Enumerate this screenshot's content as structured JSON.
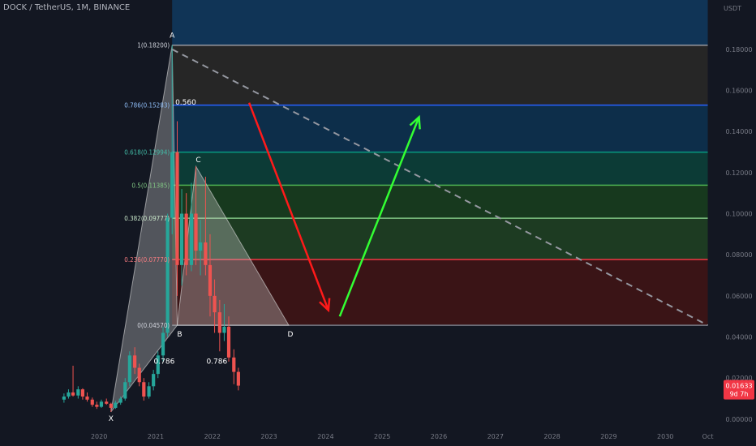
{
  "header": {
    "symbol": "DOCK / TetherUS",
    "interval": "1M",
    "exchange": "BINANCE"
  },
  "price_badge": {
    "price": "0.01633",
    "countdown": "9d 7h",
    "color": "#f23645"
  },
  "chart_data": {
    "type": "candlestick",
    "y_unit": "USDT",
    "ylim": [
      -0.004,
      0.204
    ],
    "y_ticks": [
      "0.18000",
      "0.16000",
      "0.14000",
      "0.12000",
      "0.10000",
      "0.08000",
      "0.06000",
      "0.04000",
      "0.02000",
      "0.00000"
    ],
    "y_tick_values": [
      0.18,
      0.16,
      0.14,
      0.12,
      0.1,
      0.08,
      0.06,
      0.04,
      0.02,
      0.0
    ],
    "x_ticks": [
      "2020",
      "2021",
      "2022",
      "2023",
      "2024",
      "2025",
      "2026",
      "2027",
      "2028",
      "2029",
      "2030",
      "Oct"
    ],
    "x_tick_years": [
      2020,
      2021,
      2022,
      2023,
      2024,
      2025,
      2026,
      2027,
      2028,
      2029,
      2030,
      2030.75
    ],
    "xlim": [
      2018.25,
      2031.0
    ],
    "candle_colors": {
      "up": "#26a69a",
      "down": "#ef5350"
    },
    "candles": [
      {
        "t": 2019.38,
        "o": 0.0095,
        "h": 0.0125,
        "l": 0.008,
        "c": 0.011
      },
      {
        "t": 2019.46,
        "o": 0.011,
        "h": 0.0145,
        "l": 0.01,
        "c": 0.013
      },
      {
        "t": 2019.54,
        "o": 0.013,
        "h": 0.026,
        "l": 0.011,
        "c": 0.0115
      },
      {
        "t": 2019.63,
        "o": 0.0115,
        "h": 0.016,
        "l": 0.01,
        "c": 0.0145
      },
      {
        "t": 2019.71,
        "o": 0.0145,
        "h": 0.015,
        "l": 0.0095,
        "c": 0.011
      },
      {
        "t": 2019.79,
        "o": 0.011,
        "h": 0.013,
        "l": 0.0085,
        "c": 0.0095
      },
      {
        "t": 2019.88,
        "o": 0.0095,
        "h": 0.0105,
        "l": 0.006,
        "c": 0.007
      },
      {
        "t": 2019.96,
        "o": 0.007,
        "h": 0.0085,
        "l": 0.005,
        "c": 0.006
      },
      {
        "t": 2020.04,
        "o": 0.006,
        "h": 0.0095,
        "l": 0.0055,
        "c": 0.0085
      },
      {
        "t": 2020.13,
        "o": 0.0085,
        "h": 0.01,
        "l": 0.007,
        "c": 0.0075
      },
      {
        "t": 2020.21,
        "o": 0.0075,
        "h": 0.008,
        "l": 0.0035,
        "c": 0.0055
      },
      {
        "t": 2020.29,
        "o": 0.0055,
        "h": 0.009,
        "l": 0.005,
        "c": 0.008
      },
      {
        "t": 2020.38,
        "o": 0.008,
        "h": 0.011,
        "l": 0.007,
        "c": 0.01
      },
      {
        "t": 2020.46,
        "o": 0.01,
        "h": 0.02,
        "l": 0.009,
        "c": 0.018
      },
      {
        "t": 2020.54,
        "o": 0.018,
        "h": 0.033,
        "l": 0.016,
        "c": 0.031
      },
      {
        "t": 2020.63,
        "o": 0.031,
        "h": 0.035,
        "l": 0.022,
        "c": 0.025
      },
      {
        "t": 2020.71,
        "o": 0.025,
        "h": 0.027,
        "l": 0.016,
        "c": 0.018
      },
      {
        "t": 2020.79,
        "o": 0.018,
        "h": 0.02,
        "l": 0.009,
        "c": 0.011
      },
      {
        "t": 2020.88,
        "o": 0.011,
        "h": 0.018,
        "l": 0.01,
        "c": 0.016
      },
      {
        "t": 2020.96,
        "o": 0.016,
        "h": 0.024,
        "l": 0.014,
        "c": 0.022
      },
      {
        "t": 2021.04,
        "o": 0.022,
        "h": 0.033,
        "l": 0.02,
        "c": 0.031
      },
      {
        "t": 2021.13,
        "o": 0.031,
        "h": 0.045,
        "l": 0.028,
        "c": 0.042
      },
      {
        "t": 2021.21,
        "o": 0.042,
        "h": 0.1,
        "l": 0.04,
        "c": 0.098
      },
      {
        "t": 2021.29,
        "o": 0.098,
        "h": 0.182,
        "l": 0.09,
        "c": 0.13
      },
      {
        "t": 2021.38,
        "o": 0.13,
        "h": 0.145,
        "l": 0.06,
        "c": 0.075
      },
      {
        "t": 2021.46,
        "o": 0.075,
        "h": 0.112,
        "l": 0.065,
        "c": 0.1
      },
      {
        "t": 2021.54,
        "o": 0.1,
        "h": 0.11,
        "l": 0.07,
        "c": 0.075
      },
      {
        "t": 2021.63,
        "o": 0.075,
        "h": 0.115,
        "l": 0.072,
        "c": 0.1
      },
      {
        "t": 2021.71,
        "o": 0.1,
        "h": 0.123,
        "l": 0.075,
        "c": 0.082
      },
      {
        "t": 2021.79,
        "o": 0.082,
        "h": 0.097,
        "l": 0.07,
        "c": 0.086
      },
      {
        "t": 2021.88,
        "o": 0.086,
        "h": 0.118,
        "l": 0.07,
        "c": 0.075
      },
      {
        "t": 2021.96,
        "o": 0.075,
        "h": 0.09,
        "l": 0.05,
        "c": 0.06
      },
      {
        "t": 2022.04,
        "o": 0.06,
        "h": 0.068,
        "l": 0.042,
        "c": 0.052
      },
      {
        "t": 2022.13,
        "o": 0.052,
        "h": 0.058,
        "l": 0.033,
        "c": 0.042
      },
      {
        "t": 2022.21,
        "o": 0.042,
        "h": 0.056,
        "l": 0.038,
        "c": 0.045
      },
      {
        "t": 2022.29,
        "o": 0.045,
        "h": 0.05,
        "l": 0.028,
        "c": 0.03
      },
      {
        "t": 2022.38,
        "o": 0.03,
        "h": 0.034,
        "l": 0.017,
        "c": 0.023
      },
      {
        "t": 2022.46,
        "o": 0.023,
        "h": 0.025,
        "l": 0.014,
        "c": 0.0163
      }
    ],
    "fib_levels": [
      {
        "label": "1(0.18200)",
        "value": 0.182,
        "line": "#9598a1",
        "label_color": "#d1d4dc"
      },
      {
        "label": "0.786(0.15283)",
        "value": 0.15283,
        "line": "#2962ff",
        "label_color": "#90bff9"
      },
      {
        "label": "0.618(0.12994)",
        "value": 0.12994,
        "line": "#089981",
        "label_color": "#42bda8"
      },
      {
        "label": "0.5(0.11385)",
        "value": 0.11385,
        "line": "#4caf50",
        "label_color": "#81c784"
      },
      {
        "label": "0.382(0.09777)",
        "value": 0.09777,
        "line": "#81c784",
        "label_color": "#c8e6c9"
      },
      {
        "label": "0.236(0.07770)",
        "value": 0.0777,
        "line": "#f23645",
        "label_color": "#f77c80"
      },
      {
        "label": "0(0.04570)",
        "value": 0.0457,
        "line": "#787b86",
        "label_color": "#d1d4dc"
      }
    ],
    "fib_fills": [
      "#0d3b66",
      "#262626",
      "#0d2e4a",
      "#0c3b36",
      "#17391e",
      "#1d3b22",
      "#3a1416"
    ],
    "fib_top_fill": "#103456",
    "fib_x_range": [
      2021.29,
      2030.75
    ],
    "pattern_points": [
      {
        "label": "X",
        "t": 2020.21,
        "v": 0.0035
      },
      {
        "label": "A",
        "t": 2021.29,
        "v": 0.182
      },
      {
        "label": "B",
        "t": 2021.38,
        "v": 0.0457
      },
      {
        "label": "C",
        "t": 2021.71,
        "v": 0.123
      },
      {
        "label": "D",
        "t": 2023.35,
        "v": 0.0457
      }
    ],
    "pattern_ratios": [
      {
        "label": "0.786",
        "t": 2021.15,
        "v": 0.027
      },
      {
        "label": "0.786",
        "t": 2022.08,
        "v": 0.027
      },
      {
        "label": "0.560",
        "t": 2021.53,
        "v": 0.153
      }
    ],
    "trend_line": {
      "from": [
        2021.29,
        0.18
      ],
      "to": [
        2030.75,
        0.0457
      ],
      "color": "#9598a1"
    },
    "arrows": [
      {
        "from": [
          2022.65,
          0.154
        ],
        "to": [
          2024.05,
          0.053
        ],
        "color": "#ff1a1a"
      },
      {
        "from": [
          2024.25,
          0.05
        ],
        "to": [
          2025.65,
          0.147
        ],
        "color": "#33ff33"
      }
    ]
  }
}
